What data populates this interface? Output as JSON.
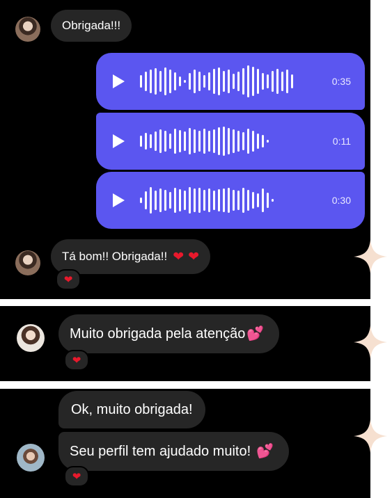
{
  "panel1": {
    "msg1": "Obrigada!!!",
    "voice_messages": [
      {
        "duration": "0:35"
      },
      {
        "duration": "0:11"
      },
      {
        "duration": "0:30"
      }
    ],
    "msg2": "Tá bom!! Obrigada!!",
    "msg2_emoji": "❤️❤️",
    "reaction": "❤️"
  },
  "panel2": {
    "msg": "Muito obrigada pela atenção",
    "msg_emoji": "💕",
    "reaction": "❤️"
  },
  "panel3": {
    "msg1": "Ok, muito obrigada!",
    "msg2": "Seu perfil tem ajudado muito!",
    "msg2_emoji": "💕",
    "reaction": "❤️"
  },
  "colors": {
    "voice_bubble": "#5b56f0",
    "incoming_bubble": "#262626",
    "background": "#000000",
    "star": "#f6e0d0"
  }
}
